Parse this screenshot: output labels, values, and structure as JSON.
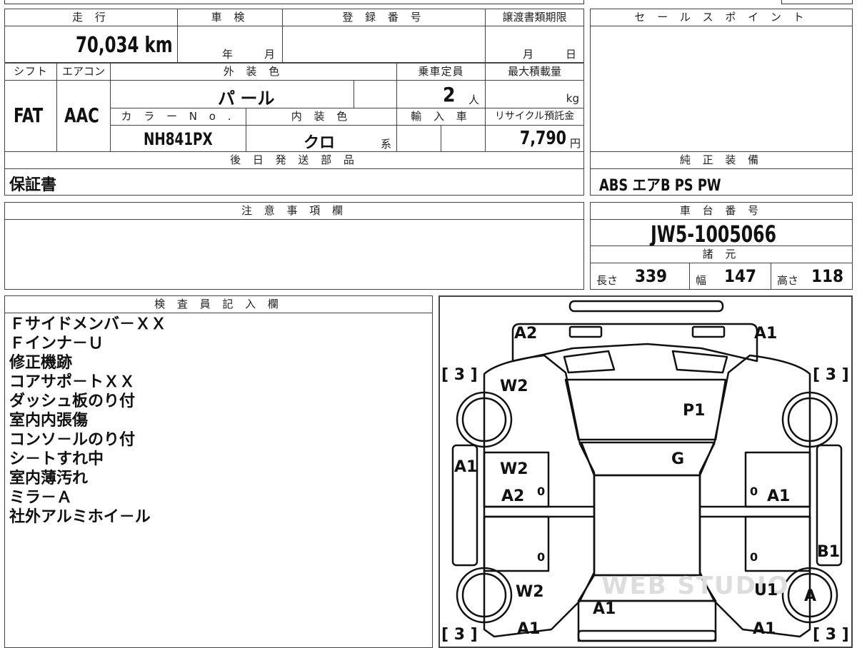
{
  "top_left": {
    "mileage": {
      "label": "走 行",
      "value": "70,034 km"
    },
    "inspection": {
      "label": "車 検",
      "year": "年",
      "month": "月"
    },
    "registration": {
      "label": "登 録 番 号",
      "value": ""
    },
    "transfer_deadline": {
      "label": "譲渡書類期限",
      "month": "月",
      "day": "日"
    },
    "shift": {
      "label": "シフト",
      "value": "FAT"
    },
    "aircon": {
      "label": "エアコン",
      "value": "AAC"
    },
    "exterior_color": {
      "label": "外 装 色",
      "value": "パ ール"
    },
    "capacity": {
      "label": "乗車定員",
      "value": "2",
      "unit": "人"
    },
    "max_load": {
      "label": "最大積載量",
      "value": "",
      "unit": "kg"
    },
    "color_no": {
      "label": "カ ラ ー N o .",
      "value": "NH841PX"
    },
    "interior_color": {
      "label": "内 装 色",
      "value": "クロ",
      "suffix": "系"
    },
    "import": {
      "label": "輸 入 車",
      "value": ""
    },
    "recycle": {
      "label": "リサイクル預託金",
      "value": "7,790",
      "unit": "円"
    },
    "later_parts": {
      "label": "後 日 発 送 部 品",
      "value": "保証書"
    }
  },
  "sales_point": {
    "label": "セ ー ル ス ポ イ ン ト",
    "value": ""
  },
  "genuine_equipment": {
    "label": "純 正 装 備",
    "value": "ABS エアB PS PW"
  },
  "caution": {
    "label": "注 意 事 項 欄",
    "value": ""
  },
  "chassis": {
    "label": "車 台 番 号",
    "value": "JW5-1005066"
  },
  "specs": {
    "label": "諸 元",
    "length_label": "長さ",
    "length": "339",
    "width_label": "幅",
    "width": "147",
    "height_label": "高さ",
    "height": "118"
  },
  "inspector": {
    "label": "検 査 員 記 入 欄",
    "notes": [
      "Ｆサイドメンバ－ＸＸ",
      "Ｆインナ－Ｕ",
      "修正機跡",
      "コアサポ－トＸＸ",
      "ダッシュ板のり付",
      "室内内張傷",
      "コンソ－ルのり付",
      "シ－トすれ中",
      "室内薄汚れ",
      "ミラ－Ａ",
      "社外アルミホイ－ル"
    ]
  },
  "diagram": {
    "marks": [
      "A2",
      "A1",
      "W2",
      "P1",
      "G",
      "A1",
      "W2",
      "A2",
      "A1",
      "B1",
      "W2",
      "A1",
      "U1",
      "A",
      "A1",
      "A1",
      "[ 3 ]",
      "[ 3 ]",
      "[ 3 ]",
      "[ 3 ]",
      "0",
      "0",
      "0",
      "0"
    ],
    "watermark": "WEB STUDIO"
  }
}
